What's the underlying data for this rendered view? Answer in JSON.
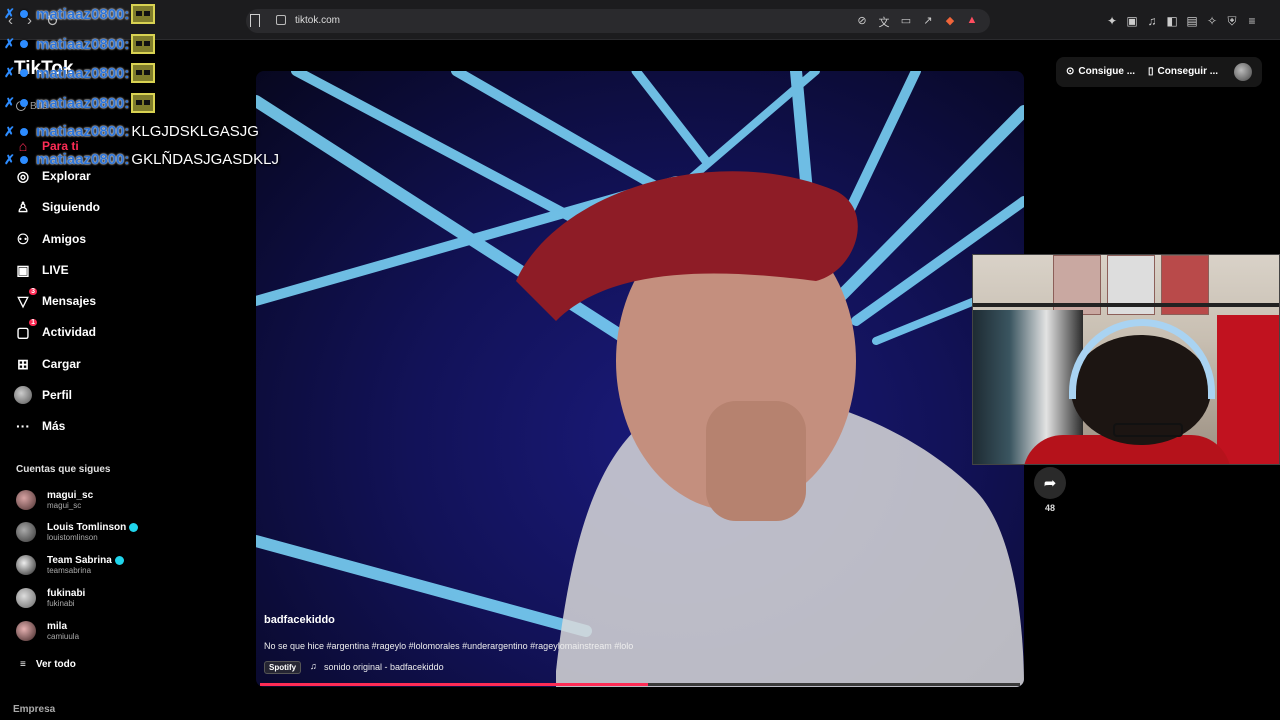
{
  "browser": {
    "url": "tiktok.com"
  },
  "chat": {
    "messages": [
      {
        "user": "matiaaz0800:",
        "text": "",
        "emote": true
      },
      {
        "user": "matiaaz0800:",
        "text": "",
        "emote": true
      },
      {
        "user": "matiaaz0800:",
        "text": "",
        "emote": true
      },
      {
        "user": "matiaaz0800:",
        "text": "",
        "emote": true
      },
      {
        "user": "matiaaz0800:",
        "text": "KLGJDSKLGASJG",
        "emote": false
      },
      {
        "user": "matiaaz0800:",
        "text": "GKLÑDASJGASDKLJ",
        "emote": false
      }
    ]
  },
  "sidebar": {
    "logo": "TikTok",
    "search_placeholder": "Bus",
    "nav": [
      {
        "label": "Para ti",
        "icon": "home-icon"
      },
      {
        "label": "Explorar",
        "icon": "compass-icon"
      },
      {
        "label": "Siguiendo",
        "icon": "following-icon"
      },
      {
        "label": "Amigos",
        "icon": "friends-icon"
      },
      {
        "label": "LIVE",
        "icon": "live-icon"
      },
      {
        "label": "Mensajes",
        "icon": "messages-icon",
        "badge": "3"
      },
      {
        "label": "Actividad",
        "icon": "activity-icon",
        "badge": "1"
      },
      {
        "label": "Cargar",
        "icon": "upload-icon"
      },
      {
        "label": "Perfil",
        "icon": "profile-avatar"
      },
      {
        "label": "Más",
        "icon": "more-icon"
      }
    ],
    "following_title": "Cuentas que sigues",
    "accounts": [
      {
        "name": "magui_sc",
        "handle": "magui_sc",
        "verified": false
      },
      {
        "name": "Louis Tomlinson",
        "handle": "louistomlinson",
        "verified": true
      },
      {
        "name": "Team Sabrina",
        "handle": "teamsabrina",
        "verified": true
      },
      {
        "name": "fukinabi",
        "handle": "fukinabi",
        "verified": false
      },
      {
        "name": "mila",
        "handle": "camiuula",
        "verified": false
      }
    ],
    "see_all": "Ver todo",
    "company": "Empresa"
  },
  "topright": {
    "btn1": "Consigue ...",
    "btn2": "Conseguir ..."
  },
  "video": {
    "author": "badfacekiddo",
    "description": "No se que hice  #argentina #rageylo #lolomorales #underargentino #rageylomainstream #lolo",
    "spotify": "Spotify",
    "music": "sonido original - badfacekiddo",
    "progress": 0.51,
    "share_count": "48"
  },
  "colors": {
    "accent": "#fe2c55",
    "chat_user": "#2d74d8"
  }
}
